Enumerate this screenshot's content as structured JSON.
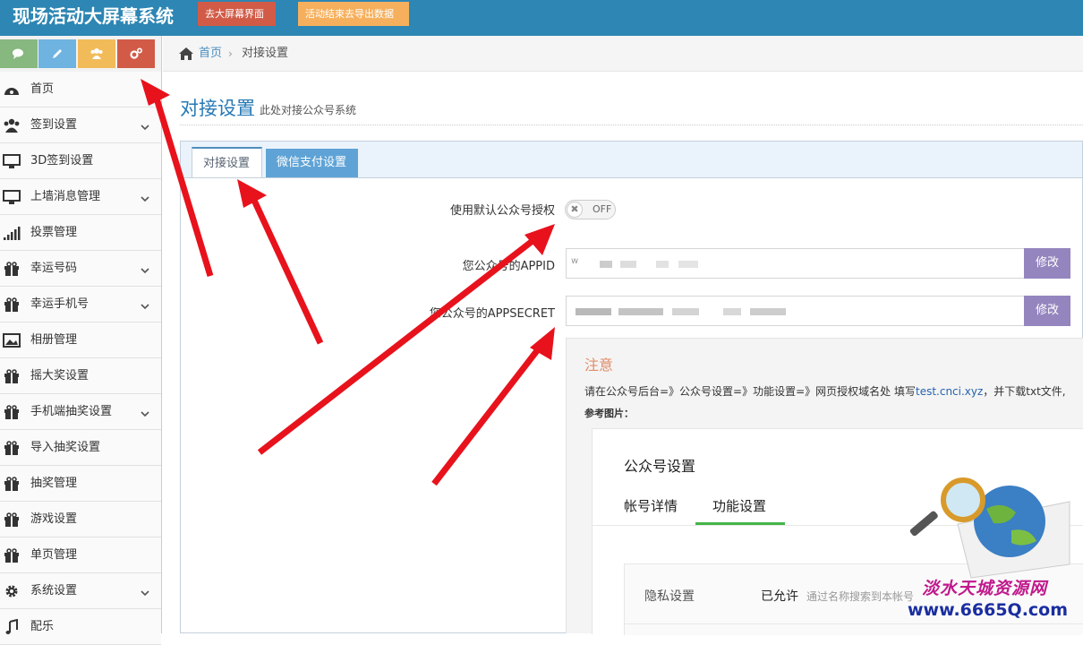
{
  "header": {
    "app_title": "现场活动大屏幕系统",
    "btn_bigscreen": "去大屏幕界面",
    "btn_export": "活动结束去导出数据"
  },
  "shortcuts": [
    {
      "icon": "comments-icon",
      "color": "#87b87f"
    },
    {
      "icon": "pencil-icon",
      "color": "#6fb3e0"
    },
    {
      "icon": "users-icon",
      "color": "#f2bb5a"
    },
    {
      "icon": "cogs-icon",
      "color": "#d15b47"
    }
  ],
  "sidebar": {
    "items": [
      {
        "label": "首页",
        "icon": "dashboard-icon",
        "expandable": false
      },
      {
        "label": "签到设置",
        "icon": "users-icon",
        "expandable": true
      },
      {
        "label": "3D签到设置",
        "icon": "desktop-icon",
        "expandable": false
      },
      {
        "label": "上墙消息管理",
        "icon": "desktop-icon",
        "expandable": true
      },
      {
        "label": "投票管理",
        "icon": "signal-icon",
        "expandable": false
      },
      {
        "label": "幸运号码",
        "icon": "gift-icon",
        "expandable": true
      },
      {
        "label": "幸运手机号",
        "icon": "gift-icon",
        "expandable": true
      },
      {
        "label": "相册管理",
        "icon": "picture-icon",
        "expandable": false
      },
      {
        "label": "摇大奖设置",
        "icon": "gift-icon",
        "expandable": false
      },
      {
        "label": "手机端抽奖设置",
        "icon": "gift-icon",
        "expandable": true
      },
      {
        "label": "导入抽奖设置",
        "icon": "gift-icon",
        "expandable": false
      },
      {
        "label": "抽奖管理",
        "icon": "gift-icon",
        "expandable": false
      },
      {
        "label": "游戏设置",
        "icon": "gift-icon",
        "expandable": false
      },
      {
        "label": "单页管理",
        "icon": "gift-icon",
        "expandable": false
      },
      {
        "label": "系统设置",
        "icon": "gear-icon",
        "expandable": true
      },
      {
        "label": "配乐",
        "icon": "music-icon",
        "expandable": false
      }
    ]
  },
  "breadcrumb": {
    "home": "首页",
    "current": "对接设置",
    "separator": "›"
  },
  "page": {
    "title": "对接设置",
    "subtitle": "此处对接公众号系统"
  },
  "tabs": [
    {
      "label": "对接设置",
      "active": true
    },
    {
      "label": "微信支付设置",
      "active": false
    }
  ],
  "form": {
    "default_auth_label": "使用默认公众号授权",
    "toggle_state": "OFF",
    "appid_label": "您公众号的APPID",
    "appsecret_label": "您公众号的APPSECRET",
    "modify_label": "修改",
    "appid_value_prefix": "w"
  },
  "notice": {
    "title": "注意",
    "text_before": "请在公众号后台=》公众号设置=》功能设置=》网页授权域名处 填写",
    "domain": "test.cnci.xyz",
    "text_after": "，并下载txt文件,",
    "ref_label": "参考图片："
  },
  "reference_image": {
    "title": "公众号设置",
    "tab1": "帐号详情",
    "tab2": "功能设置",
    "row_key": "隐私设置",
    "row_value": "已允许",
    "row_desc": "通过名称搜索到本帐号"
  },
  "watermark": {
    "line1": "淡水天城资源网",
    "line2": "www.6665Q.com"
  },
  "colors": {
    "topbar": "#2d86b3",
    "btn_red": "#d15b47",
    "btn_orange": "#f6b05d",
    "link_blue": "#4c8fbd",
    "modify_purple": "#9585bf",
    "notice_title": "#e08e6c",
    "arrow_red": "#e8121c"
  }
}
